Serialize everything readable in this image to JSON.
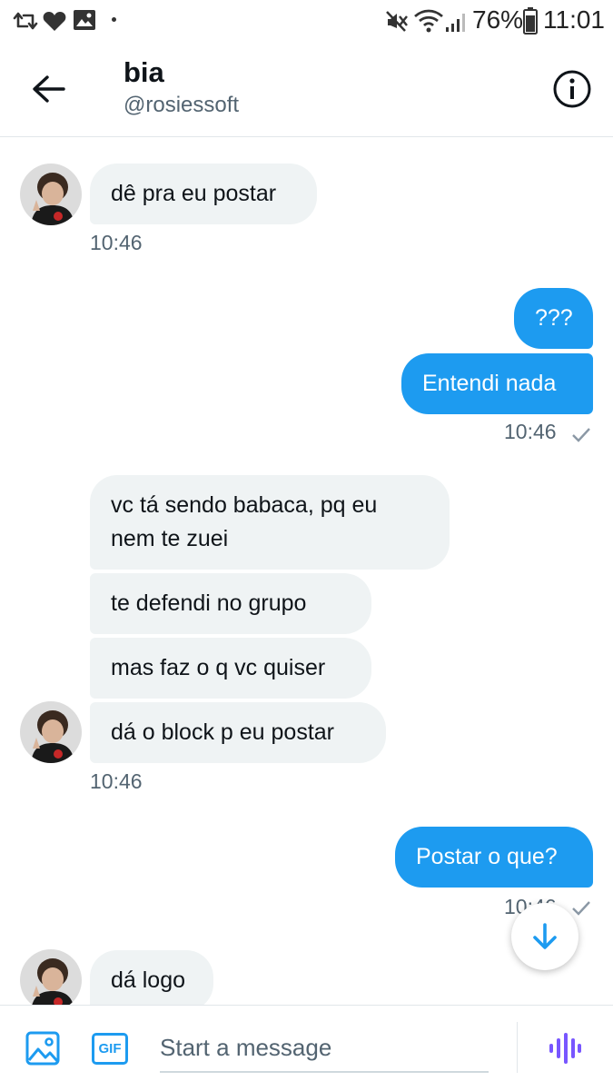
{
  "status_bar": {
    "battery": "76%",
    "time": "11:01"
  },
  "header": {
    "name": "bia",
    "handle": "@rosiessoft"
  },
  "messages": {
    "m1": "dê pra eu postar",
    "t1": "10:46",
    "m2": "???",
    "m3": "Entendi nada",
    "t2": "10:46",
    "m4_line1": "vc tá sendo babaca, pq eu",
    "m4_line2": "nem te zuei",
    "m5": "te defendi no grupo",
    "m6": "mas faz o q vc quiser",
    "m7": "dá o block p eu postar",
    "t3": "10:46",
    "m8": "Postar o que?",
    "t4": "10:46",
    "m9": "dá logo"
  },
  "composer": {
    "placeholder": "Start a message",
    "gif_label": "GIF"
  },
  "colors": {
    "accent": "#1d9bf0",
    "incoming_bubble": "#eff3f4",
    "voice_icon": "#7856ff"
  },
  "icons": [
    "retweet-icon",
    "heart-icon",
    "image-icon",
    "mute-icon",
    "wifi-icon",
    "signal-icon",
    "battery-icon",
    "back-arrow-icon",
    "info-icon",
    "check-icon",
    "arrow-down-icon",
    "media-icon",
    "gif-icon",
    "voice-icon"
  ]
}
